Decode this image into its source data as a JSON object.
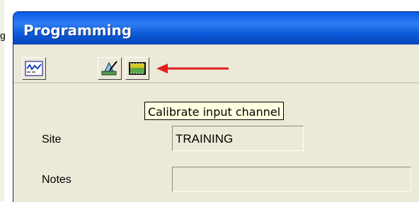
{
  "left_edge_label": "g",
  "window": {
    "title": "Programming"
  },
  "toolbar": {
    "buttons": [
      {
        "icon": "waveform-chart-icon"
      },
      {
        "icon": "pencil-chart-icon"
      },
      {
        "icon": "calibrate-icon"
      }
    ]
  },
  "tooltip": {
    "text": "Calibrate input channel"
  },
  "annotation": {
    "arrow_color": "#e32020"
  },
  "form": {
    "site_label": "Site",
    "site_value": "TRAINING",
    "notes_label": "Notes",
    "notes_value": ""
  },
  "colors": {
    "titlebar": "#0a5ae8",
    "window_bg": "#ece9d8",
    "tooltip_bg": "#ffffe1"
  }
}
